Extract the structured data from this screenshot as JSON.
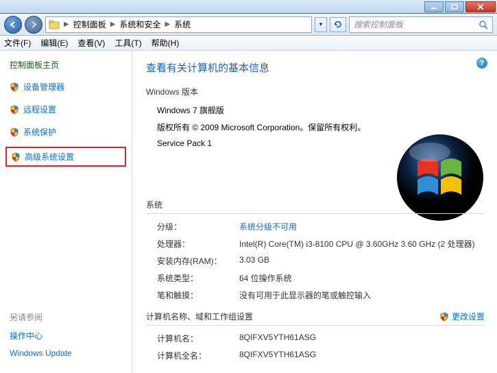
{
  "titlebar": {},
  "breadcrumb": [
    "控制面板",
    "系统和安全",
    "系统"
  ],
  "search": {
    "placeholder": "搜索控制面板"
  },
  "menu": {
    "file": "文件(F)",
    "edit": "编辑(E)",
    "view": "查看(V)",
    "tools": "工具(T)",
    "help": "帮助(H)"
  },
  "sidebar": {
    "home": "控制面板主页",
    "links": [
      "设备管理器",
      "远程设置",
      "系统保护",
      "高级系统设置"
    ],
    "seealso_title": "另请参阅",
    "seealso": [
      "操作中心",
      "Windows Update"
    ]
  },
  "content": {
    "heading": "查看有关计算机的基本信息",
    "win_edition_label": "Windows 版本",
    "win_name": "Windows 7 旗舰版",
    "copyright": "版权所有 © 2009 Microsoft Corporation。保留所有权利。",
    "service_pack": "Service Pack 1",
    "system_label": "系统",
    "rating_k": "分级：",
    "rating_v": "系统分级不可用",
    "cpu_k": "处理器：",
    "cpu_v": "Intel(R) Core(TM) i3-8100 CPU @ 3.60GHz   3.60 GHz  (2 处理器)",
    "ram_k": "安装内存(RAM)：",
    "ram_v": "3.03 GB",
    "systype_k": "系统类型：",
    "systype_v": "64 位操作系统",
    "pen_k": "笔和触摸：",
    "pen_v": "没有可用于此显示器的笔或触控输入",
    "computer_label": "计算机名称、域和工作组设置",
    "cname_k": "计算机名：",
    "cname_v": "8QIFXV5YTH61ASG",
    "cfull_k": "计算机全名：",
    "cfull_v": "8QIFXV5YTH61ASG",
    "change_settings": "更改设置"
  }
}
